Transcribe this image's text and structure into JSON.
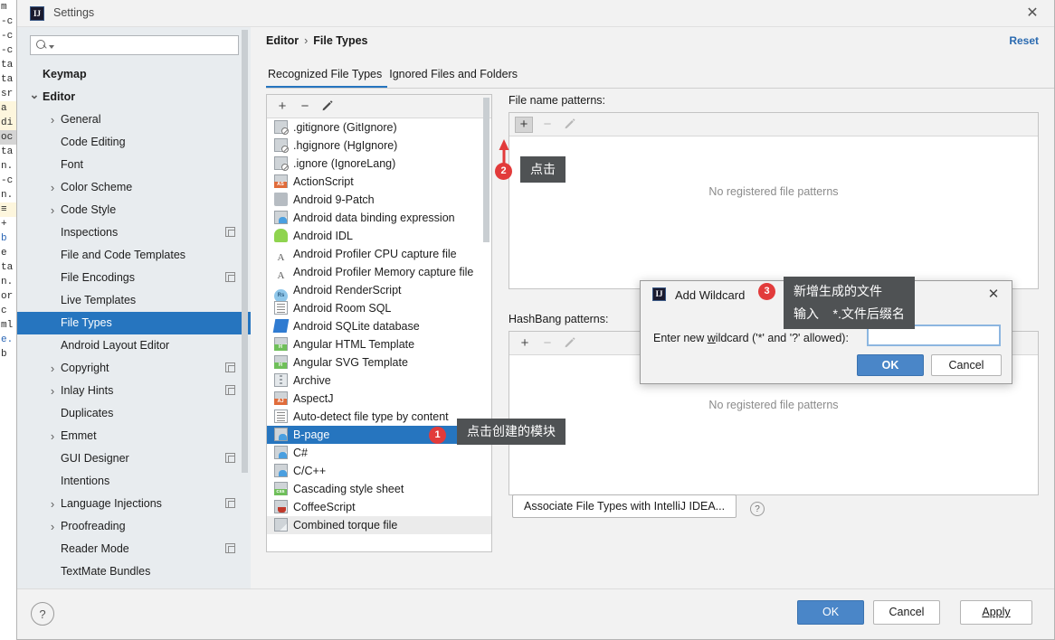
{
  "background_ide": {
    "lines": [
      "m",
      "",
      "-c",
      "-c",
      "-c",
      "ta",
      "ta",
      "sr",
      "a",
      "di",
      "oc",
      "ta",
      "n.",
      "-c",
      "",
      "n.",
      "≡",
      "+",
      "",
      "",
      "",
      "",
      "",
      "b",
      "e",
      "ta",
      "n.",
      "or",
      "c",
      "ml",
      "e.",
      "b"
    ]
  },
  "window": {
    "title": "Settings",
    "icon": "intellij-idea-icon",
    "close_label": "✕"
  },
  "search": {
    "value": "",
    "placeholder": "",
    "icon": "search-icon"
  },
  "sidebar": {
    "items": [
      {
        "label": "Keymap",
        "level": 0,
        "arrow": "",
        "badge": false,
        "selected": false
      },
      {
        "label": "Editor",
        "level": 0,
        "arrow": "v",
        "badge": false,
        "selected": false
      },
      {
        "label": "General",
        "level": 1,
        "arrow": ">",
        "badge": false,
        "selected": false
      },
      {
        "label": "Code Editing",
        "level": 1,
        "arrow": "",
        "badge": false,
        "selected": false
      },
      {
        "label": "Font",
        "level": 1,
        "arrow": "",
        "badge": false,
        "selected": false
      },
      {
        "label": "Color Scheme",
        "level": 1,
        "arrow": ">",
        "badge": false,
        "selected": false
      },
      {
        "label": "Code Style",
        "level": 1,
        "arrow": ">",
        "badge": false,
        "selected": false
      },
      {
        "label": "Inspections",
        "level": 1,
        "arrow": "",
        "badge": true,
        "selected": false
      },
      {
        "label": "File and Code Templates",
        "level": 1,
        "arrow": "",
        "badge": false,
        "selected": false
      },
      {
        "label": "File Encodings",
        "level": 1,
        "arrow": "",
        "badge": true,
        "selected": false
      },
      {
        "label": "Live Templates",
        "level": 1,
        "arrow": "",
        "badge": false,
        "selected": false
      },
      {
        "label": "File Types",
        "level": 1,
        "arrow": "",
        "badge": false,
        "selected": true
      },
      {
        "label": "Android Layout Editor",
        "level": 1,
        "arrow": "",
        "badge": false,
        "selected": false
      },
      {
        "label": "Copyright",
        "level": 1,
        "arrow": ">",
        "badge": true,
        "selected": false
      },
      {
        "label": "Inlay Hints",
        "level": 1,
        "arrow": ">",
        "badge": true,
        "selected": false
      },
      {
        "label": "Duplicates",
        "level": 1,
        "arrow": "",
        "badge": false,
        "selected": false
      },
      {
        "label": "Emmet",
        "level": 1,
        "arrow": ">",
        "badge": false,
        "selected": false
      },
      {
        "label": "GUI Designer",
        "level": 1,
        "arrow": "",
        "badge": true,
        "selected": false
      },
      {
        "label": "Intentions",
        "level": 1,
        "arrow": "",
        "badge": false,
        "selected": false
      },
      {
        "label": "Language Injections",
        "level": 1,
        "arrow": ">",
        "badge": true,
        "selected": false
      },
      {
        "label": "Proofreading",
        "level": 1,
        "arrow": ">",
        "badge": false,
        "selected": false
      },
      {
        "label": "Reader Mode",
        "level": 1,
        "arrow": "",
        "badge": true,
        "selected": false
      },
      {
        "label": "TextMate Bundles",
        "level": 1,
        "arrow": "",
        "badge": false,
        "selected": false
      }
    ]
  },
  "main": {
    "breadcrumb": {
      "parent": "Editor",
      "separator": "›",
      "current": "File Types"
    },
    "reset_label": "Reset",
    "tabs": [
      {
        "label": "Recognized File Types",
        "active": true
      },
      {
        "label": "Ignored Files and Folders",
        "active": false
      }
    ],
    "toolbar": {
      "add": "+",
      "remove": "−",
      "edit": "pencil-icon"
    },
    "file_types": [
      {
        "label": ".gitignore (GitIgnore)",
        "icon": "ignore-file-icon"
      },
      {
        "label": ".hgignore (HgIgnore)",
        "icon": "ignore-file-icon"
      },
      {
        "label": ".ignore (IgnoreLang)",
        "icon": "ignore-file-icon"
      },
      {
        "label": "ActionScript",
        "icon": "actionscript-icon"
      },
      {
        "label": "Android 9-Patch",
        "icon": "folder-icon"
      },
      {
        "label": "Android data binding expression",
        "icon": "databinding-icon"
      },
      {
        "label": "Android IDL",
        "icon": "android-icon"
      },
      {
        "label": "Android Profiler CPU capture file",
        "icon": "profiler-icon"
      },
      {
        "label": "Android Profiler Memory capture file",
        "icon": "profiler-icon"
      },
      {
        "label": "Android RenderScript",
        "icon": "renderscript-icon"
      },
      {
        "label": "Android Room SQL",
        "icon": "sql-icon"
      },
      {
        "label": "Android SQLite database",
        "icon": "sqlite-icon"
      },
      {
        "label": "Angular HTML Template",
        "icon": "angular-html-icon"
      },
      {
        "label": "Angular SVG Template",
        "icon": "angular-svg-icon"
      },
      {
        "label": "Archive",
        "icon": "archive-icon"
      },
      {
        "label": "AspectJ",
        "icon": "aspectj-icon"
      },
      {
        "label": "Auto-detect file type by content",
        "icon": "autodetect-icon"
      },
      {
        "label": "B-page",
        "icon": "custom-file-icon",
        "selected": true
      },
      {
        "label": "C#",
        "icon": "custom-file-icon"
      },
      {
        "label": "C/C++",
        "icon": "custom-file-icon"
      },
      {
        "label": "Cascading style sheet",
        "icon": "css-icon"
      },
      {
        "label": "CoffeeScript",
        "icon": "coffeescript-icon"
      },
      {
        "label": "Combined torque file",
        "icon": "generic-file-icon",
        "ghost": true
      }
    ],
    "patterns": {
      "file_name_label": "File name patterns:",
      "file_name_empty": "No registered file patterns",
      "hashbang_label": "HashBang patterns:",
      "hashbang_empty": "No registered file patterns",
      "toolbar": {
        "add": "+",
        "remove": "−",
        "edit": "pencil-icon"
      }
    },
    "associate_button": "Associate File Types with IntelliJ IDEA...",
    "associate_help": "?"
  },
  "bottom": {
    "help": "?",
    "ok": "OK",
    "cancel": "Cancel",
    "apply": "Apply"
  },
  "wildcard_dialog": {
    "title": "Add Wildcard",
    "icon": "intellij-idea-icon",
    "close_label": "✕",
    "label_prefix": "Enter new ",
    "label_underline": "w",
    "label_suffix": "ildcard ('*' and '?' allowed):",
    "input_value": "",
    "ok": "OK",
    "cancel": "Cancel"
  },
  "annotations": [
    {
      "number": "1",
      "text": "点击创建的模块"
    },
    {
      "number": "2",
      "text": "点击"
    },
    {
      "number": "3",
      "text": "新增生成的文件\n输入    *.文件后缀名"
    }
  ],
  "colors": {
    "accent": "#2675bf",
    "primary_button": "#4a86c8",
    "annotation_badge": "#e23b3b",
    "annotation_bubble": "#4f5254",
    "link": "#2a6ab0"
  }
}
